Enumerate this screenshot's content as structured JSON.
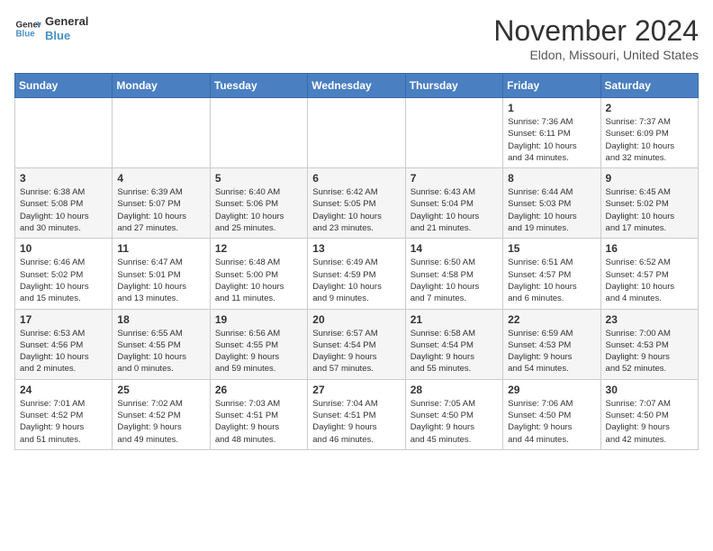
{
  "header": {
    "logo_line1": "General",
    "logo_line2": "Blue",
    "month": "November 2024",
    "location": "Eldon, Missouri, United States"
  },
  "weekdays": [
    "Sunday",
    "Monday",
    "Tuesday",
    "Wednesday",
    "Thursday",
    "Friday",
    "Saturday"
  ],
  "weeks": [
    [
      {
        "day": "",
        "info": ""
      },
      {
        "day": "",
        "info": ""
      },
      {
        "day": "",
        "info": ""
      },
      {
        "day": "",
        "info": ""
      },
      {
        "day": "",
        "info": ""
      },
      {
        "day": "1",
        "info": "Sunrise: 7:36 AM\nSunset: 6:11 PM\nDaylight: 10 hours\nand 34 minutes."
      },
      {
        "day": "2",
        "info": "Sunrise: 7:37 AM\nSunset: 6:09 PM\nDaylight: 10 hours\nand 32 minutes."
      }
    ],
    [
      {
        "day": "3",
        "info": "Sunrise: 6:38 AM\nSunset: 5:08 PM\nDaylight: 10 hours\nand 30 minutes."
      },
      {
        "day": "4",
        "info": "Sunrise: 6:39 AM\nSunset: 5:07 PM\nDaylight: 10 hours\nand 27 minutes."
      },
      {
        "day": "5",
        "info": "Sunrise: 6:40 AM\nSunset: 5:06 PM\nDaylight: 10 hours\nand 25 minutes."
      },
      {
        "day": "6",
        "info": "Sunrise: 6:42 AM\nSunset: 5:05 PM\nDaylight: 10 hours\nand 23 minutes."
      },
      {
        "day": "7",
        "info": "Sunrise: 6:43 AM\nSunset: 5:04 PM\nDaylight: 10 hours\nand 21 minutes."
      },
      {
        "day": "8",
        "info": "Sunrise: 6:44 AM\nSunset: 5:03 PM\nDaylight: 10 hours\nand 19 minutes."
      },
      {
        "day": "9",
        "info": "Sunrise: 6:45 AM\nSunset: 5:02 PM\nDaylight: 10 hours\nand 17 minutes."
      }
    ],
    [
      {
        "day": "10",
        "info": "Sunrise: 6:46 AM\nSunset: 5:02 PM\nDaylight: 10 hours\nand 15 minutes."
      },
      {
        "day": "11",
        "info": "Sunrise: 6:47 AM\nSunset: 5:01 PM\nDaylight: 10 hours\nand 13 minutes."
      },
      {
        "day": "12",
        "info": "Sunrise: 6:48 AM\nSunset: 5:00 PM\nDaylight: 10 hours\nand 11 minutes."
      },
      {
        "day": "13",
        "info": "Sunrise: 6:49 AM\nSunset: 4:59 PM\nDaylight: 10 hours\nand 9 minutes."
      },
      {
        "day": "14",
        "info": "Sunrise: 6:50 AM\nSunset: 4:58 PM\nDaylight: 10 hours\nand 7 minutes."
      },
      {
        "day": "15",
        "info": "Sunrise: 6:51 AM\nSunset: 4:57 PM\nDaylight: 10 hours\nand 6 minutes."
      },
      {
        "day": "16",
        "info": "Sunrise: 6:52 AM\nSunset: 4:57 PM\nDaylight: 10 hours\nand 4 minutes."
      }
    ],
    [
      {
        "day": "17",
        "info": "Sunrise: 6:53 AM\nSunset: 4:56 PM\nDaylight: 10 hours\nand 2 minutes."
      },
      {
        "day": "18",
        "info": "Sunrise: 6:55 AM\nSunset: 4:55 PM\nDaylight: 10 hours\nand 0 minutes."
      },
      {
        "day": "19",
        "info": "Sunrise: 6:56 AM\nSunset: 4:55 PM\nDaylight: 9 hours\nand 59 minutes."
      },
      {
        "day": "20",
        "info": "Sunrise: 6:57 AM\nSunset: 4:54 PM\nDaylight: 9 hours\nand 57 minutes."
      },
      {
        "day": "21",
        "info": "Sunrise: 6:58 AM\nSunset: 4:54 PM\nDaylight: 9 hours\nand 55 minutes."
      },
      {
        "day": "22",
        "info": "Sunrise: 6:59 AM\nSunset: 4:53 PM\nDaylight: 9 hours\nand 54 minutes."
      },
      {
        "day": "23",
        "info": "Sunrise: 7:00 AM\nSunset: 4:53 PM\nDaylight: 9 hours\nand 52 minutes."
      }
    ],
    [
      {
        "day": "24",
        "info": "Sunrise: 7:01 AM\nSunset: 4:52 PM\nDaylight: 9 hours\nand 51 minutes."
      },
      {
        "day": "25",
        "info": "Sunrise: 7:02 AM\nSunset: 4:52 PM\nDaylight: 9 hours\nand 49 minutes."
      },
      {
        "day": "26",
        "info": "Sunrise: 7:03 AM\nSunset: 4:51 PM\nDaylight: 9 hours\nand 48 minutes."
      },
      {
        "day": "27",
        "info": "Sunrise: 7:04 AM\nSunset: 4:51 PM\nDaylight: 9 hours\nand 46 minutes."
      },
      {
        "day": "28",
        "info": "Sunrise: 7:05 AM\nSunset: 4:50 PM\nDaylight: 9 hours\nand 45 minutes."
      },
      {
        "day": "29",
        "info": "Sunrise: 7:06 AM\nSunset: 4:50 PM\nDaylight: 9 hours\nand 44 minutes."
      },
      {
        "day": "30",
        "info": "Sunrise: 7:07 AM\nSunset: 4:50 PM\nDaylight: 9 hours\nand 42 minutes."
      }
    ]
  ]
}
